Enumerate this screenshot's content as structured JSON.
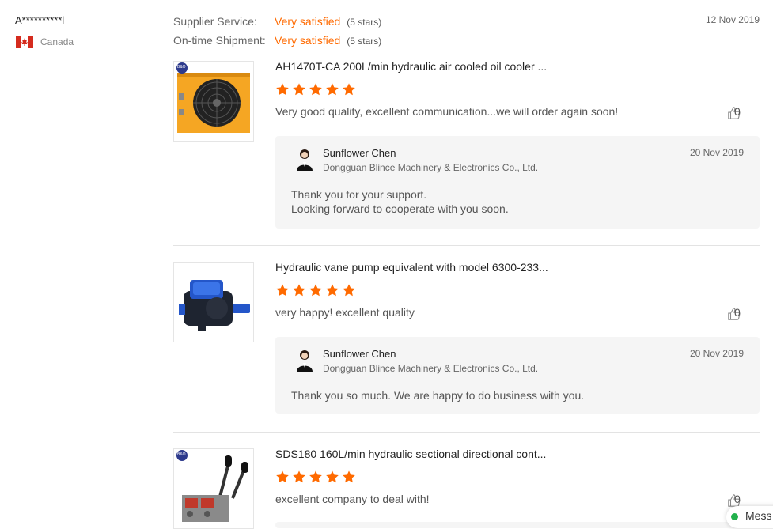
{
  "buyer": {
    "name": "A**********l",
    "country": "Canada",
    "flag_icon": "canada-flag-icon"
  },
  "ratings": [
    {
      "label": "Supplier Service:",
      "value": "Very satisfied",
      "stars": "(5 stars)"
    },
    {
      "label": "On-time Shipment:",
      "value": "Very satisfied",
      "stars": "(5 stars)"
    }
  ],
  "review_date": "12 Nov 2019",
  "reviews": [
    {
      "product_title": "AH1470T-CA 200L/min hydraulic air cooled oil cooler ...",
      "rating": 5,
      "text": "Very good quality, excellent communication...we will order again soon!",
      "likes": "0",
      "reply": {
        "name": "Sunflower Chen",
        "company": "Dongguan Blince Machinery & Electronics Co., Ltd.",
        "date": "20 Nov 2019",
        "text_line1": "Thank you for your support.",
        "text_line2": "Looking forward to cooperate with you soon."
      }
    },
    {
      "product_title": "Hydraulic vane pump equivalent with model 6300-233...",
      "rating": 5,
      "text": "very happy! excellent quality",
      "likes": "0",
      "reply": {
        "name": "Sunflower Chen",
        "company": "Dongguan Blince Machinery & Electronics Co., Ltd.",
        "date": "20 Nov 2019",
        "text_line1": "Thank you so much. We are happy to do business with you."
      }
    },
    {
      "product_title": "SDS180 160L/min hydraulic sectional directional cont...",
      "rating": 5,
      "text": "excellent company to deal with!",
      "likes": "0"
    }
  ],
  "brand_badge": "B&O",
  "message_widget": {
    "label": "Mess"
  },
  "colors": {
    "accent": "#ff6a00",
    "star": "#ff6a00",
    "online": "#22b14c"
  }
}
